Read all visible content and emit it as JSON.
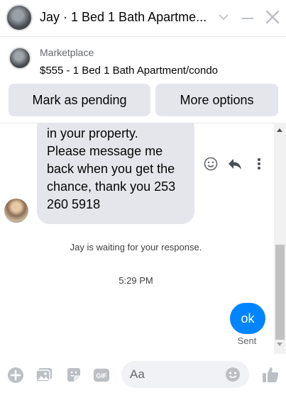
{
  "header": {
    "title": "Jay · 1 Bed 1 Bath Apartme...",
    "icons": [
      "avatar",
      "chevron-down-icon",
      "minimize-icon",
      "close-icon"
    ]
  },
  "marketplace": {
    "label": "Marketplace",
    "listing": "$555 - 1 Bed 1 Bath Apartment/condo",
    "mark_pending_label": "Mark as pending",
    "more_options_label": "More options"
  },
  "conversation": {
    "incoming_lines": [
      "in your property.",
      "Please message me",
      "back when you get the",
      "chance, thank you 253",
      "260 5918"
    ],
    "waiting_text": "Jay is waiting for your response.",
    "timestamp": "5:29 PM",
    "outgoing_text": "ok",
    "sent_status": "Sent"
  },
  "composer": {
    "placeholder": "Aa",
    "icons": [
      "plus-icon",
      "photo-icon",
      "sticker-icon",
      "gif-icon",
      "emoji-icon",
      "thumbs-up-icon"
    ]
  },
  "colors": {
    "accent": "#0084ff",
    "bubble_gray": "#e4e6eb",
    "icon_gray": "#bcc0c4"
  }
}
